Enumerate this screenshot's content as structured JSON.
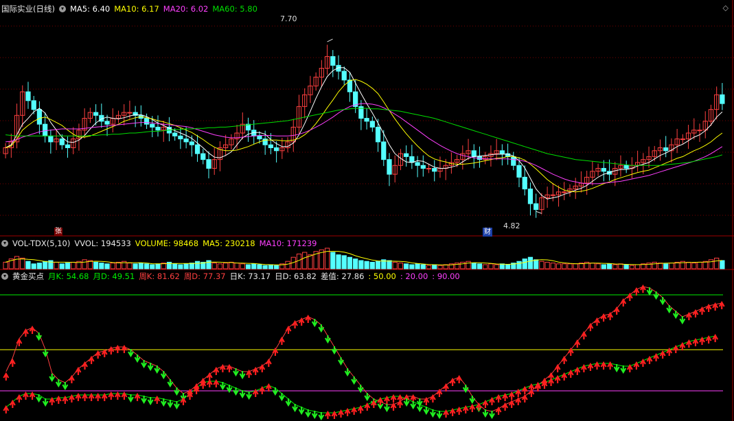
{
  "colors": {
    "up": "#ff4040",
    "down": "#54ffff",
    "ma5": "#ffffff",
    "ma10": "#ffff00",
    "ma20": "#ff40ff",
    "ma60": "#00e000",
    "green": "#00ee00",
    "yellow": "#ffff00",
    "magenta": "#ff40ff",
    "white": "#e8e8e8",
    "grid": "#7a0000"
  },
  "header_price": {
    "title": "国际实业(日线)",
    "items": [
      {
        "text": "MA5: 6.40",
        "color": "#ffffff"
      },
      {
        "text": "MA10: 6.17",
        "color": "#ffff00"
      },
      {
        "text": "MA20: 6.02",
        "color": "#ff40ff"
      },
      {
        "text": "MA60: 5.80",
        "color": "#00e000"
      }
    ]
  },
  "header_volume": {
    "title": "VOL-TDX(5,10)",
    "items": [
      {
        "text": "VVOL: 194533",
        "color": "#e8e8e8"
      },
      {
        "text": "VOLUME: 98468",
        "color": "#ffff00"
      },
      {
        "text": "MA5: 230218",
        "color": "#ffff00"
      },
      {
        "text": "MA10: 171239",
        "color": "#ff40ff"
      }
    ]
  },
  "header_indicator": {
    "title": "黄金买点",
    "items": [
      {
        "text": "月K: 54.68",
        "color": "#00ee00"
      },
      {
        "text": "月D: 49.51",
        "color": "#00ee00"
      },
      {
        "text": "周K: 81.62",
        "color": "#ff4040"
      },
      {
        "text": "周D: 77.37",
        "color": "#ff4040"
      },
      {
        "text": "日K: 73.17",
        "color": "#e8e8e8"
      },
      {
        "text": "日D: 63.82",
        "color": "#e8e8e8"
      },
      {
        "text": "差值: 27.86",
        "color": "#e8e8e8"
      },
      {
        "text": ": 50.00",
        "color": "#ffff00"
      },
      {
        "text": ": 20.00",
        "color": "#ff40ff"
      },
      {
        "text": ": 90.00",
        "color": "#ff40ff"
      }
    ]
  },
  "annotations": {
    "high_label": "7.70",
    "low_label": "4.82",
    "tag_zhang": "张",
    "tag_cai": "财"
  },
  "chart_data": {
    "type": "candlestick",
    "price_range": [
      4.45,
      8.2
    ],
    "high_value": 7.7,
    "low_value": 4.82,
    "closes": [
      5.9,
      6.0,
      6.45,
      6.85,
      6.7,
      6.55,
      6.3,
      6.1,
      6.0,
      6.05,
      5.95,
      5.9,
      6.05,
      6.2,
      6.4,
      6.5,
      6.45,
      6.35,
      6.3,
      6.4,
      6.45,
      6.5,
      6.5,
      6.45,
      6.4,
      6.3,
      6.25,
      6.2,
      6.25,
      6.15,
      6.1,
      6.05,
      6.0,
      5.95,
      5.8,
      5.7,
      5.55,
      5.7,
      5.9,
      5.95,
      6.05,
      6.15,
      6.3,
      6.2,
      6.1,
      6.05,
      5.95,
      5.9,
      5.85,
      5.9,
      6.0,
      6.25,
      6.6,
      6.8,
      6.95,
      7.1,
      7.25,
      7.45,
      7.3,
      7.2,
      7.05,
      6.85,
      6.6,
      6.4,
      6.35,
      6.25,
      6.0,
      5.7,
      5.45,
      5.6,
      5.8,
      5.75,
      5.65,
      5.6,
      5.55,
      5.55,
      5.5,
      5.55,
      5.6,
      5.65,
      5.7,
      5.8,
      5.85,
      5.75,
      5.7,
      5.75,
      5.8,
      5.85,
      5.8,
      5.75,
      5.6,
      5.4,
      5.2,
      4.95,
      4.85,
      5.05,
      5.1,
      5.1,
      5.15,
      5.15,
      5.2,
      5.25,
      5.3,
      5.4,
      5.5,
      5.55,
      5.5,
      5.45,
      5.55,
      5.6,
      5.55,
      5.6,
      5.65,
      5.7,
      5.75,
      5.85,
      5.9,
      5.85,
      5.95,
      6.05,
      6.05,
      6.15,
      6.2,
      6.2,
      6.35,
      6.55,
      6.8,
      6.65
    ],
    "ma_series": [
      {
        "name": "MA5",
        "values": [
          5.9,
          5.95,
          6.12,
          6.3,
          6.4,
          6.51,
          6.57,
          6.49,
          6.33,
          6.2,
          6.08,
          6.0,
          5.99,
          6.03,
          6.11,
          6.22,
          6.32,
          6.39,
          6.42,
          6.4,
          6.39,
          6.41,
          6.44,
          6.46,
          6.46,
          6.43,
          6.38,
          6.32,
          6.28,
          6.23,
          6.19,
          6.15,
          6.11,
          6.06,
          5.98,
          5.9,
          5.81,
          5.74,
          5.73,
          5.77,
          5.83,
          5.95,
          6.07,
          6.13,
          6.16,
          6.16,
          6.13,
          6.04,
          5.97,
          5.92,
          5.92,
          5.98,
          6.12,
          6.31,
          6.52,
          6.74,
          6.94,
          7.11,
          7.21,
          7.26,
          7.26,
          7.18,
          7.0,
          6.82,
          6.65,
          6.49,
          6.32,
          6.14,
          5.95,
          5.8,
          5.72,
          5.66,
          5.65,
          5.68,
          5.67,
          5.62,
          5.57,
          5.55,
          5.55,
          5.57,
          5.6,
          5.66,
          5.72,
          5.75,
          5.76,
          5.77,
          5.78,
          5.79,
          5.79,
          5.79,
          5.76,
          5.68,
          5.56,
          5.38,
          5.2,
          5.09,
          5.03,
          5.05,
          5.07,
          5.11,
          5.14,
          5.18,
          5.21,
          5.26,
          5.33,
          5.4,
          5.45,
          5.48,
          5.51,
          5.53,
          5.53,
          5.55,
          5.59,
          5.62,
          5.65,
          5.71,
          5.77,
          5.81,
          5.86,
          5.92,
          5.96,
          6.02,
          6.08,
          6.12,
          6.19,
          6.29,
          6.42,
          6.51
        ]
      },
      {
        "name": "MA10",
        "values": [
          5.9,
          5.93,
          6.05,
          6.2,
          6.28,
          6.35,
          6.4,
          6.42,
          6.38,
          6.33,
          6.28,
          6.2,
          6.13,
          6.08,
          6.08,
          6.1,
          6.14,
          6.18,
          6.22,
          6.26,
          6.3,
          6.35,
          6.38,
          6.41,
          6.43,
          6.41,
          6.39,
          6.36,
          6.34,
          6.31,
          6.28,
          6.24,
          6.2,
          6.16,
          6.1,
          6.04,
          5.97,
          5.91,
          5.87,
          5.85,
          5.85,
          5.86,
          5.89,
          5.92,
          5.96,
          6.0,
          6.03,
          6.03,
          6.03,
          6.02,
          6.02,
          6.03,
          6.06,
          6.12,
          6.2,
          6.31,
          6.44,
          6.58,
          6.71,
          6.85,
          6.96,
          7.04,
          7.06,
          7.03,
          6.98,
          6.91,
          6.82,
          6.68,
          6.53,
          6.39,
          6.26,
          6.14,
          6.03,
          5.93,
          5.84,
          5.76,
          5.71,
          5.68,
          5.66,
          5.63,
          5.62,
          5.62,
          5.63,
          5.64,
          5.66,
          5.68,
          5.7,
          5.72,
          5.73,
          5.75,
          5.75,
          5.73,
          5.69,
          5.62,
          5.54,
          5.45,
          5.36,
          5.29,
          5.23,
          5.18,
          5.16,
          5.15,
          5.16,
          5.18,
          5.21,
          5.25,
          5.29,
          5.32,
          5.36,
          5.39,
          5.42,
          5.45,
          5.48,
          5.5,
          5.52,
          5.56,
          5.6,
          5.64,
          5.68,
          5.72,
          5.75,
          5.8,
          5.85,
          5.89,
          5.94,
          6.0,
          6.08,
          6.15
        ]
      },
      {
        "name": "MA20",
        "values": [
          6.0,
          6.01,
          6.04,
          6.08,
          6.11,
          6.14,
          6.17,
          6.19,
          6.2,
          6.21,
          6.22,
          6.22,
          6.22,
          6.22,
          6.23,
          6.24,
          6.25,
          6.26,
          6.27,
          6.28,
          6.29,
          6.3,
          6.31,
          6.32,
          6.33,
          6.33,
          6.32,
          6.31,
          6.3,
          6.29,
          6.28,
          6.27,
          6.26,
          6.24,
          6.21,
          6.18,
          6.15,
          6.12,
          6.1,
          6.08,
          6.07,
          6.07,
          6.08,
          6.09,
          6.1,
          6.11,
          6.11,
          6.11,
          6.1,
          6.1,
          6.1,
          6.11,
          6.13,
          6.16,
          6.2,
          6.25,
          6.3,
          6.36,
          6.42,
          6.49,
          6.55,
          6.6,
          6.63,
          6.65,
          6.65,
          6.64,
          6.62,
          6.58,
          6.53,
          6.47,
          6.41,
          6.34,
          6.27,
          6.2,
          6.13,
          6.06,
          6.0,
          5.94,
          5.89,
          5.84,
          5.8,
          5.77,
          5.75,
          5.73,
          5.72,
          5.71,
          5.71,
          5.71,
          5.71,
          5.71,
          5.7,
          5.69,
          5.67,
          5.64,
          5.6,
          5.55,
          5.5,
          5.45,
          5.41,
          5.37,
          5.34,
          5.32,
          5.3,
          5.29,
          5.29,
          5.29,
          5.3,
          5.31,
          5.32,
          5.33,
          5.35,
          5.37,
          5.39,
          5.41,
          5.43,
          5.46,
          5.49,
          5.52,
          5.55,
          5.58,
          5.61,
          5.64,
          5.67,
          5.71,
          5.75,
          5.8,
          5.86,
          5.92
        ]
      },
      {
        "name": "MA60",
        "values": [
          6.12,
          6.11,
          6.1,
          6.1,
          6.1,
          6.1,
          6.1,
          6.1,
          6.1,
          6.1,
          6.1,
          6.1,
          6.1,
          6.1,
          6.1,
          6.11,
          6.11,
          6.12,
          6.12,
          6.13,
          6.13,
          6.14,
          6.15,
          6.15,
          6.16,
          6.17,
          6.18,
          6.18,
          6.19,
          6.2,
          6.21,
          6.21,
          6.22,
          6.22,
          6.23,
          6.23,
          6.24,
          6.24,
          6.25,
          6.25,
          6.26,
          6.27,
          6.28,
          6.29,
          6.3,
          6.31,
          6.32,
          6.33,
          6.34,
          6.35,
          6.36,
          6.38,
          6.4,
          6.42,
          6.44,
          6.46,
          6.48,
          6.5,
          6.52,
          6.54,
          6.55,
          6.56,
          6.57,
          6.57,
          6.57,
          6.56,
          6.56,
          6.55,
          6.54,
          6.53,
          6.52,
          6.5,
          6.48,
          6.46,
          6.44,
          6.42,
          6.4,
          6.37,
          6.34,
          6.31,
          6.28,
          6.25,
          6.22,
          6.19,
          6.16,
          6.13,
          6.1,
          6.07,
          6.04,
          6.01,
          5.98,
          5.95,
          5.92,
          5.89,
          5.86,
          5.83,
          5.8,
          5.78,
          5.76,
          5.74,
          5.72,
          5.7,
          5.69,
          5.68,
          5.67,
          5.66,
          5.65,
          5.64,
          5.63,
          5.62,
          5.61,
          5.6,
          5.6,
          5.6,
          5.6,
          5.6,
          5.6,
          5.61,
          5.62,
          5.63,
          5.64,
          5.65,
          5.67,
          5.69,
          5.71,
          5.73,
          5.75,
          5.78
        ]
      }
    ],
    "volume_range": [
      0,
      300000
    ],
    "volumes": [
      80,
      120,
      150,
      130,
      90,
      60,
      70,
      90,
      100,
      80,
      60,
      70,
      80,
      90,
      110,
      100,
      80,
      70,
      60,
      70,
      80,
      90,
      70,
      60,
      70,
      60,
      50,
      60,
      70,
      80,
      60,
      50,
      60,
      70,
      90,
      80,
      100,
      70,
      60,
      70,
      80,
      70,
      60,
      50,
      60,
      50,
      40,
      50,
      40,
      60,
      90,
      140,
      180,
      200,
      170,
      210,
      230,
      250,
      200,
      170,
      160,
      140,
      120,
      100,
      90,
      80,
      90,
      110,
      100,
      80,
      70,
      60,
      50,
      60,
      50,
      40,
      50,
      40,
      50,
      60,
      70,
      80,
      90,
      70,
      60,
      50,
      60,
      50,
      60,
      50,
      70,
      90,
      120,
      140,
      110,
      90,
      80,
      70,
      60,
      60,
      60,
      60,
      70,
      80,
      70,
      60,
      50,
      60,
      50,
      60,
      50,
      40,
      50,
      60,
      70,
      80,
      70,
      60,
      70,
      80,
      90,
      80,
      70,
      80,
      90,
      110,
      130,
      100
    ],
    "indicator_range": [
      0,
      100
    ],
    "week_k": [
      30,
      40,
      55,
      62,
      64,
      60,
      48,
      30,
      26,
      24,
      28,
      34,
      38,
      42,
      46,
      47,
      49,
      50,
      50,
      48,
      44,
      40,
      38,
      36,
      32,
      26,
      20,
      16,
      18,
      22,
      26,
      30,
      34,
      36,
      36,
      34,
      32,
      32,
      34,
      36,
      40,
      48,
      56,
      64,
      68,
      70,
      72,
      70,
      66,
      58,
      50,
      42,
      34,
      28,
      22,
      16,
      12,
      10,
      8,
      8,
      10,
      14,
      14,
      12,
      12,
      14,
      18,
      22,
      26,
      28,
      22,
      14,
      8,
      4,
      3,
      5,
      8,
      10,
      12,
      14,
      18,
      22,
      26,
      30,
      36,
      42,
      48,
      54,
      60,
      66,
      70,
      73,
      74,
      78,
      84,
      88,
      92,
      94,
      93,
      90,
      86,
      80,
      76,
      72,
      74,
      76,
      78,
      80,
      81,
      82
    ],
    "week_d": [
      34,
      44,
      58,
      64,
      66,
      62,
      50,
      33,
      28,
      26,
      30,
      36,
      40,
      44,
      48,
      49,
      51,
      52,
      52,
      50,
      46,
      42,
      40,
      38,
      34,
      28,
      22,
      18,
      20,
      24,
      28,
      32,
      36,
      38,
      38,
      36,
      34,
      34,
      36,
      38,
      42,
      50,
      58,
      66,
      70,
      72,
      74,
      72,
      68,
      60,
      52,
      44,
      36,
      30,
      24,
      18,
      14,
      12,
      10,
      10,
      12,
      16,
      16,
      14,
      14,
      16,
      20,
      24,
      28,
      30,
      24,
      16,
      10,
      6,
      5,
      7,
      10,
      12,
      14,
      16,
      20,
      24,
      28,
      32,
      38,
      44,
      50,
      56,
      62,
      68,
      72,
      75,
      76,
      80,
      86,
      90,
      94,
      96,
      95,
      92,
      88,
      82,
      78,
      74,
      76,
      78,
      80,
      82,
      83,
      84
    ],
    "month_k": [
      6,
      10,
      14,
      16,
      16,
      15,
      12,
      12,
      13,
      13,
      14,
      15,
      15,
      15,
      15,
      15,
      16,
      16,
      16,
      15,
      15,
      14,
      13,
      13,
      12,
      11,
      10,
      12,
      16,
      20,
      24,
      25,
      25,
      24,
      22,
      20,
      18,
      17,
      18,
      20,
      22,
      20,
      16,
      12,
      8,
      6,
      4,
      3,
      2,
      2,
      2,
      3,
      4,
      5,
      6,
      8,
      10,
      12,
      13,
      14,
      14,
      12,
      10,
      8,
      6,
      4,
      3,
      3,
      4,
      5,
      6,
      7,
      8,
      10,
      12,
      14,
      15,
      16,
      18,
      20,
      22,
      23,
      24,
      26,
      28,
      30,
      32,
      34,
      36,
      37,
      38,
      38,
      38,
      37,
      36,
      36,
      38,
      40,
      42,
      44,
      46,
      48,
      50,
      52,
      54,
      55,
      56,
      57,
      58
    ],
    "month_d": [
      8,
      12,
      16,
      18,
      18,
      17,
      14,
      14,
      15,
      15,
      16,
      17,
      17,
      17,
      17,
      17,
      18,
      18,
      18,
      17,
      17,
      16,
      15,
      15,
      14,
      13,
      12,
      14,
      18,
      22,
      26,
      27,
      27,
      26,
      24,
      22,
      20,
      19,
      20,
      22,
      24,
      22,
      18,
      14,
      10,
      8,
      6,
      5,
      4,
      4,
      4,
      5,
      6,
      7,
      8,
      10,
      12,
      14,
      15,
      16,
      16,
      14,
      12,
      10,
      8,
      6,
      5,
      5,
      6,
      7,
      8,
      9,
      10,
      12,
      14,
      16,
      17,
      18,
      20,
      22,
      24,
      25,
      26,
      28,
      30,
      32,
      34,
      36,
      38,
      39,
      40,
      40,
      40,
      39,
      38,
      38,
      40,
      42,
      44,
      46,
      48,
      50,
      52,
      54,
      56,
      57,
      58,
      59,
      60
    ],
    "levels": [
      {
        "value": 50,
        "color": "#ffff00"
      },
      {
        "value": 20,
        "color": "#ff40ff"
      },
      {
        "value": 90,
        "color": "#00ee00"
      }
    ]
  }
}
